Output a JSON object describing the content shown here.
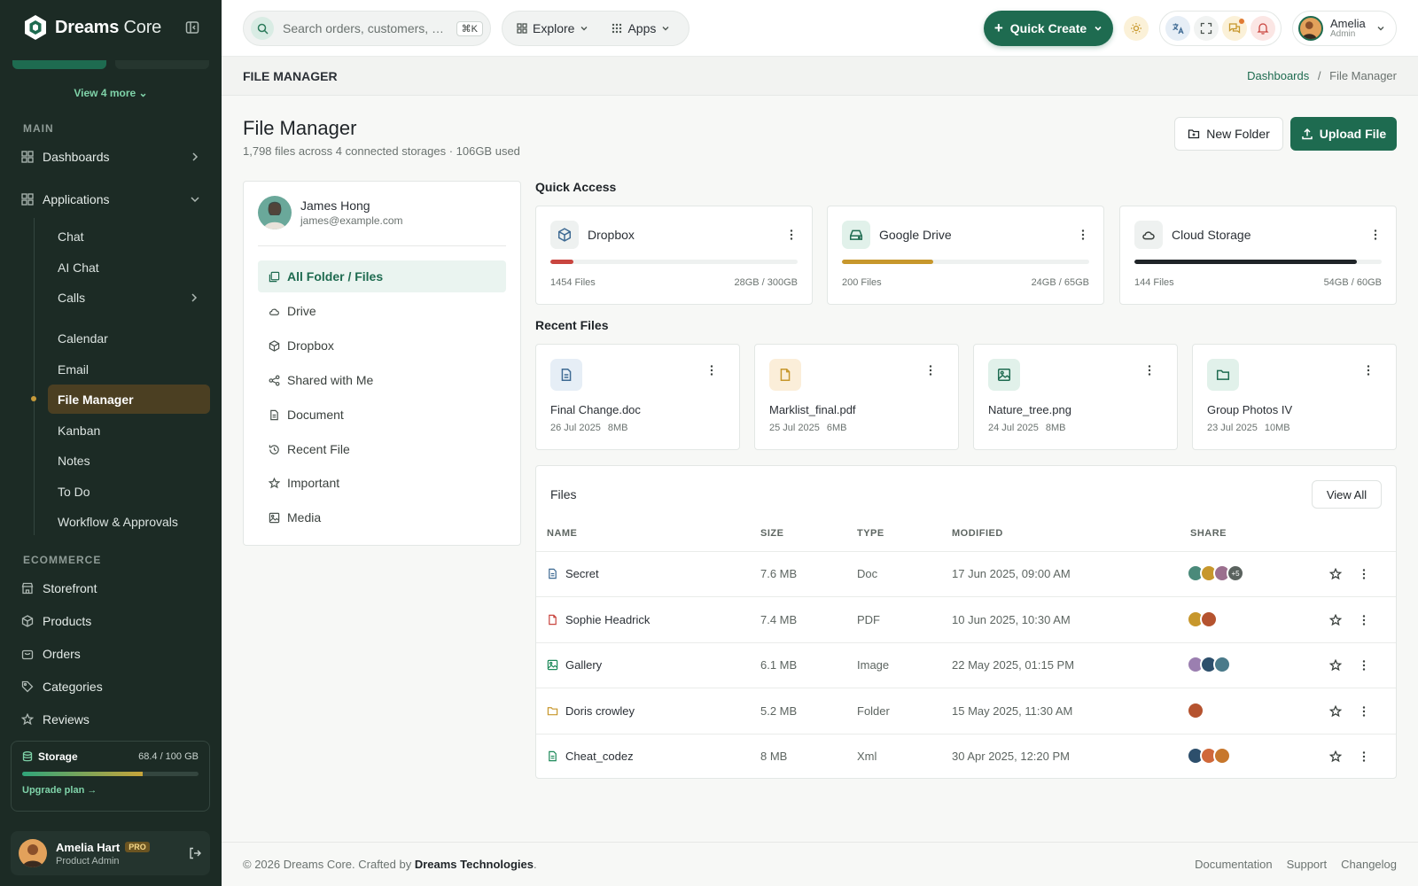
{
  "brand": {
    "name_bold": "Dreams",
    "name_light": "Core",
    "accent": "#1e6b50",
    "sidebar_bg": "#1c2b25"
  },
  "sidebar": {
    "view_more": "View 4 more",
    "sections": {
      "main": "MAIN",
      "ecommerce": "ECOMMERCE"
    },
    "main_items": [
      {
        "label": "Dashboards",
        "icon": "grid-icon"
      },
      {
        "label": "Applications",
        "icon": "grid-icon"
      }
    ],
    "apps": [
      "Chat",
      "AI Chat",
      "Calls",
      "Calendar",
      "Email",
      "File Manager",
      "Kanban",
      "Notes",
      "To Do",
      "Workflow & Approvals"
    ],
    "active_app": "File Manager",
    "ecommerce_items": [
      {
        "label": "Storefront",
        "icon": "store-icon"
      },
      {
        "label": "Products",
        "icon": "box-icon"
      },
      {
        "label": "Orders",
        "icon": "bag-icon"
      },
      {
        "label": "Categories",
        "icon": "tag-icon"
      },
      {
        "label": "Reviews",
        "icon": "star-icon"
      }
    ],
    "storage": {
      "label": "Storage",
      "value": "68.4 / 100 GB",
      "used_fraction": 0.684,
      "upgrade": "Upgrade plan"
    },
    "user": {
      "name": "Amelia Hart",
      "badge": "PRO",
      "role": "Product Admin"
    }
  },
  "topbar": {
    "search_placeholder": "Search orders, customers, …",
    "shortcut": "⌘K",
    "menus": [
      "Explore",
      "Apps"
    ],
    "quick_create": "Quick Create",
    "profile": {
      "name": "Amelia",
      "role": "Admin"
    }
  },
  "page": {
    "strip_title": "FILE MANAGER",
    "breadcrumb_root": "Dashboards",
    "breadcrumb_sep": "/",
    "breadcrumb_current": "File Manager"
  },
  "main": {
    "title": "File Manager",
    "subtitle": "1,798 files across 4 connected storages · 106GB used",
    "new_folder": "New Folder",
    "upload": "Upload File"
  },
  "fm_user": {
    "name": "James Hong",
    "email": "james@example.com"
  },
  "fm_nav": [
    {
      "label": "All Folder / Files",
      "icon": "folders-icon"
    },
    {
      "label": "Drive",
      "icon": "cloud-icon"
    },
    {
      "label": "Dropbox",
      "icon": "box-icon"
    },
    {
      "label": "Shared with Me",
      "icon": "share-icon"
    },
    {
      "label": "Document",
      "icon": "document-icon"
    },
    {
      "label": "Recent File",
      "icon": "history-icon"
    },
    {
      "label": "Important",
      "icon": "star-icon"
    },
    {
      "label": "Media",
      "icon": "image-icon"
    }
  ],
  "quick_access": {
    "title": "Quick Access",
    "items": [
      {
        "name": "Dropbox",
        "files": "1454 Files",
        "usage": "28GB / 300GB",
        "fraction": 0.093,
        "color": "#c9453f",
        "icon": "box-icon"
      },
      {
        "name": "Google Drive",
        "files": "200 Files",
        "usage": "24GB / 65GB",
        "fraction": 0.369,
        "color": "#c7972c",
        "icon": "drive-icon"
      },
      {
        "name": "Cloud Storage",
        "files": "144 Files",
        "usage": "54GB / 60GB",
        "fraction": 0.9,
        "color": "#1f2428",
        "icon": "cloud-icon"
      }
    ]
  },
  "recent": {
    "title": "Recent Files",
    "items": [
      {
        "name": "Final Change.doc",
        "date": "26 Jul 2025",
        "size": "8MB",
        "icon": "document-icon",
        "bg": "#e6eef6",
        "fg": "#3e6a93"
      },
      {
        "name": "Marklist_final.pdf",
        "date": "25 Jul 2025",
        "size": "6MB",
        "icon": "file-icon",
        "bg": "#fbeed9",
        "fg": "#c7972c"
      },
      {
        "name": "Nature_tree.png",
        "date": "24 Jul 2025",
        "size": "8MB",
        "icon": "image-icon",
        "bg": "#e1f1ea",
        "fg": "#1e6b50"
      },
      {
        "name": "Group Photos IV",
        "date": "23 Jul 2025",
        "size": "10MB",
        "icon": "folder-icon",
        "bg": "#e1f1ea",
        "fg": "#1e6b50"
      }
    ]
  },
  "files": {
    "title": "Files",
    "view_all": "View All",
    "columns": [
      "NAME",
      "SIZE",
      "TYPE",
      "MODIFIED",
      "SHARE"
    ],
    "rows": [
      {
        "name": "Secret",
        "size": "7.6 MB",
        "type": "Doc",
        "modified": "17 Jun 2025, 09:00 AM",
        "icon_color": "#3e6a93",
        "avatars": [
          "#4a8a7a",
          "#c7972c",
          "#9b6f8e"
        ],
        "more": "+5"
      },
      {
        "name": "Sophie Headrick",
        "size": "7.4 MB",
        "type": "PDF",
        "modified": "10 Jun 2025, 10:30 AM",
        "icon_color": "#c9453f",
        "avatars": [
          "#c7972c",
          "#b5532f"
        ],
        "more": ""
      },
      {
        "name": "Gallery",
        "size": "6.1 MB",
        "type": "Image",
        "modified": "22 May 2025, 01:15 PM",
        "icon_color": "#1e8a5a",
        "avatars": [
          "#9b7fb0",
          "#2d4f6c",
          "#4a7a8a"
        ],
        "more": ""
      },
      {
        "name": "Doris crowley",
        "size": "5.2 MB",
        "type": "Folder",
        "modified": "15 May 2025, 11:30 AM",
        "icon_color": "#c7972c",
        "avatars": [
          "#b5532f"
        ],
        "more": ""
      },
      {
        "name": "Cheat_codez",
        "size": "8 MB",
        "type": "Xml",
        "modified": "30 Apr 2025, 12:20 PM",
        "icon_color": "#1e8a5a",
        "avatars": [
          "#2d4f6c",
          "#d0683a",
          "#c7772c"
        ],
        "more": ""
      }
    ]
  },
  "footer": {
    "copyright": "© 2026 Dreams Core. Crafted by ",
    "company": "Dreams Technologies",
    "period": ".",
    "links": [
      "Documentation",
      "Support",
      "Changelog"
    ]
  }
}
